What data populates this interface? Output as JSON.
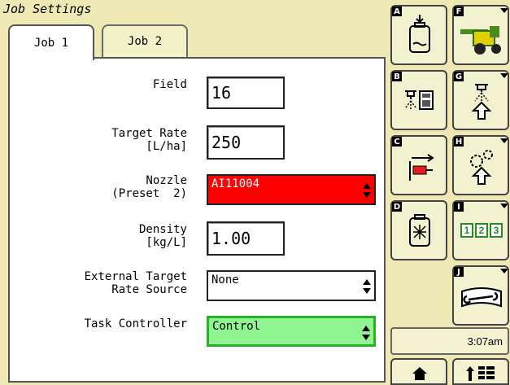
{
  "window": {
    "title": "Job Settings"
  },
  "tabs": [
    {
      "label": "Job 1",
      "active": true
    },
    {
      "label": "Job 2",
      "active": false
    }
  ],
  "form": {
    "field": {
      "label": "Field",
      "value": "16"
    },
    "target_rate": {
      "label": "Target Rate\n[L/ha]",
      "value": "250"
    },
    "nozzle": {
      "label": "Nozzle\n(Preset  2)",
      "value": "AI11004",
      "color": "#ff0000"
    },
    "density": {
      "label": "Density\n[kg/L]",
      "value": "1.00"
    },
    "external_source": {
      "label": "External Target\nRate Source",
      "value": "None"
    },
    "task_controller": {
      "label": "Task Controller",
      "value": "Control",
      "color": "#90f590"
    }
  },
  "softkeys": [
    {
      "key": "A",
      "icon": "tank-fill-icon"
    },
    {
      "key": "F",
      "icon": "sprayer-machine-icon"
    },
    {
      "key": "B",
      "icon": "nozzle-calculator-icon"
    },
    {
      "key": "G",
      "icon": "nozzle-settings-icon"
    },
    {
      "key": "C",
      "icon": "boom-nozzle-icon"
    },
    {
      "key": "H",
      "icon": "gear-settings-icon"
    },
    {
      "key": "D",
      "icon": "tank-agitation-icon"
    },
    {
      "key": "I",
      "icon": "numeric-keys-icon",
      "text": "1 2 3"
    },
    {
      "key": "J",
      "icon": "manual-wrench-icon"
    }
  ],
  "status": {
    "time": "3:07am"
  },
  "nav": [
    {
      "icon": "home-icon"
    },
    {
      "icon": "menu-up-icon"
    }
  ]
}
